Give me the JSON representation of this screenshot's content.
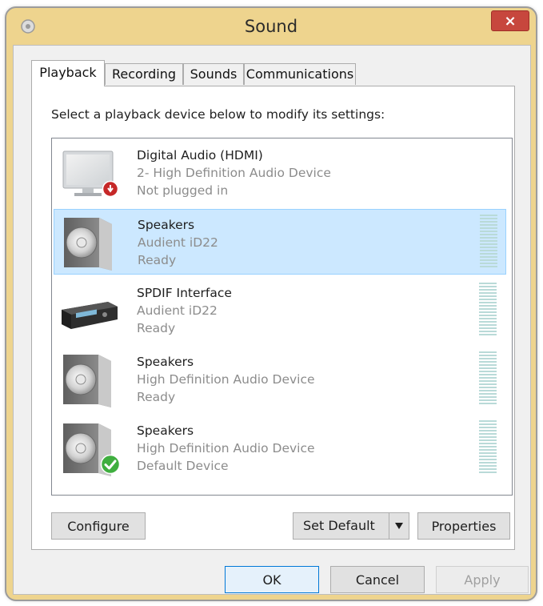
{
  "window": {
    "title": "Sound",
    "close_label": "×"
  },
  "tabs": [
    {
      "label": "Playback",
      "active": true
    },
    {
      "label": "Recording",
      "active": false
    },
    {
      "label": "Sounds",
      "active": false
    },
    {
      "label": "Communications",
      "active": false
    }
  ],
  "instructions": "Select a playback device below to modify its settings:",
  "devices": [
    {
      "name": "Digital Audio (HDMI)",
      "description": "2- High Definition Audio Device",
      "status": "Not plugged in",
      "icon": "monitor-icon",
      "badge": "unplugged-badge-icon",
      "selected": false
    },
    {
      "name": "Speakers",
      "description": "Audient iD22",
      "status": "Ready",
      "icon": "speaker-icon",
      "badge": "",
      "selected": true
    },
    {
      "name": "SPDIF Interface",
      "description": "Audient iD22",
      "status": "Ready",
      "icon": "receiver-icon",
      "badge": "",
      "selected": false
    },
    {
      "name": "Speakers",
      "description": "High Definition Audio Device",
      "status": "Ready",
      "icon": "speaker-icon",
      "badge": "",
      "selected": false
    },
    {
      "name": "Speakers",
      "description": "High Definition Audio Device",
      "status": "Default Device",
      "icon": "speaker-icon",
      "badge": "default-check-icon",
      "selected": false
    }
  ],
  "buttons": {
    "configure": "Configure",
    "set_default": "Set Default",
    "properties": "Properties",
    "ok": "OK",
    "cancel": "Cancel",
    "apply": "Apply"
  },
  "colors": {
    "title_bar": "#eed48e",
    "close_button": "#c7473d",
    "selection": "#cce8ff",
    "level_meter": "#b9dad8",
    "default_check": "#3fae3f"
  }
}
